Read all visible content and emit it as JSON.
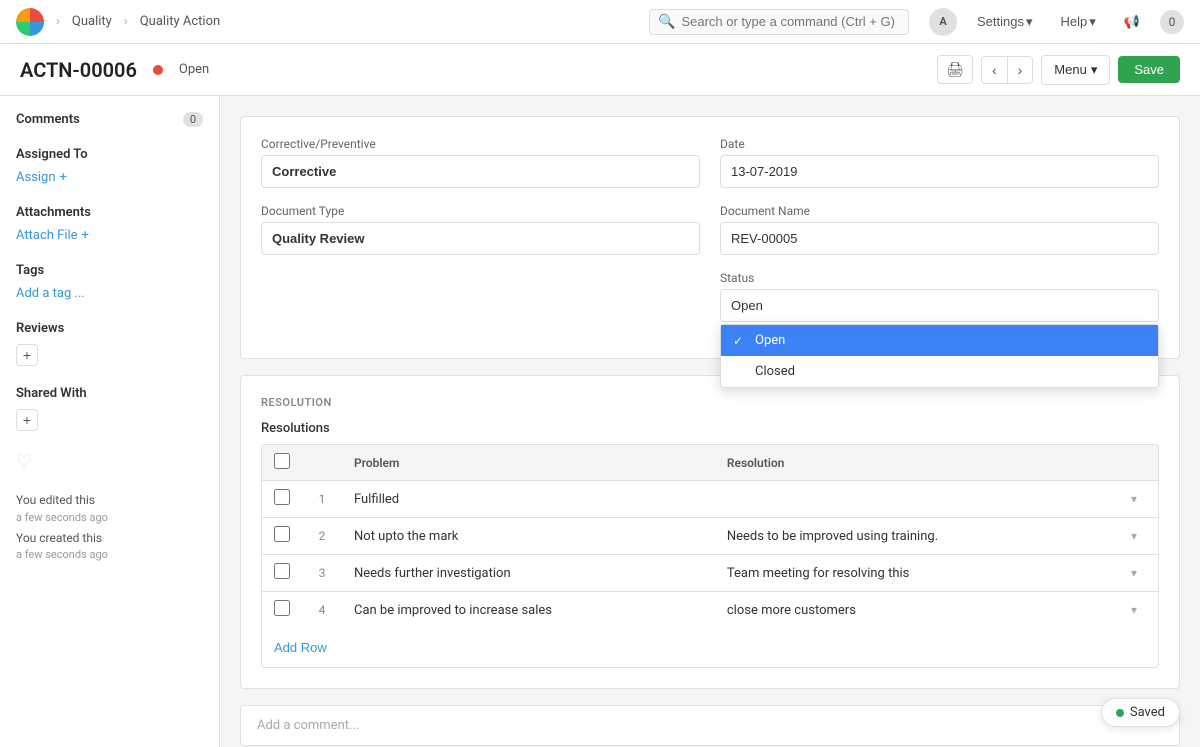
{
  "app": {
    "logo_alt": "App Logo",
    "breadcrumbs": [
      "Quality",
      "Quality Action"
    ],
    "search_placeholder": "Search or type a command (Ctrl + G)",
    "nav_avatar_label": "A",
    "settings_label": "Settings",
    "help_label": "Help",
    "notification_count": "0"
  },
  "page_header": {
    "record_id": "ACTN-00006",
    "status": "Open",
    "print_icon": "🖨",
    "prev_icon": "‹",
    "next_icon": "›",
    "menu_label": "Menu",
    "save_label": "Save"
  },
  "sidebar": {
    "comments_label": "Comments",
    "comments_count": "0",
    "assigned_to_label": "Assigned To",
    "assign_label": "Assign",
    "assign_icon": "+",
    "attachments_label": "Attachments",
    "attach_file_label": "Attach File",
    "attach_icon": "+",
    "tags_label": "Tags",
    "add_tag_label": "Add a tag ...",
    "reviews_label": "Reviews",
    "reviews_add_icon": "+",
    "shared_with_label": "Shared With",
    "shared_with_add_icon": "+",
    "heart_icon": "♡",
    "activity": [
      {
        "action": "You edited this",
        "time": "a few seconds ago"
      },
      {
        "action": "You created this",
        "time": "a few seconds ago"
      }
    ]
  },
  "form": {
    "corrective_preventive_label": "Corrective/Preventive",
    "corrective_value": "Corrective",
    "date_label": "Date",
    "date_value": "13-07-2019",
    "document_type_label": "Document Type",
    "document_type_value": "Quality Review",
    "document_name_label": "Document Name",
    "document_name_value": "REV-00005",
    "status_label": "Status",
    "status_value": "Open",
    "status_options": [
      {
        "label": "Open",
        "selected": true
      },
      {
        "label": "Closed",
        "selected": false
      }
    ]
  },
  "resolution": {
    "section_title": "RESOLUTION",
    "resolutions_label": "Resolutions",
    "columns": [
      "Problem",
      "Resolution"
    ],
    "rows": [
      {
        "num": 1,
        "problem": "Fulfilled",
        "resolution": ""
      },
      {
        "num": 2,
        "problem": "Not upto the mark",
        "resolution": "Needs to be improved using training."
      },
      {
        "num": 3,
        "problem": "Needs further investigation",
        "resolution": "Team meeting for resolving this"
      },
      {
        "num": 4,
        "problem": "Can be improved to increase sales",
        "resolution": "close more customers"
      }
    ],
    "add_row_label": "Add Row"
  },
  "comment": {
    "placeholder": "Add a comment..."
  },
  "saved_badge": {
    "label": "Saved",
    "dot_color": "#2ea44f"
  }
}
